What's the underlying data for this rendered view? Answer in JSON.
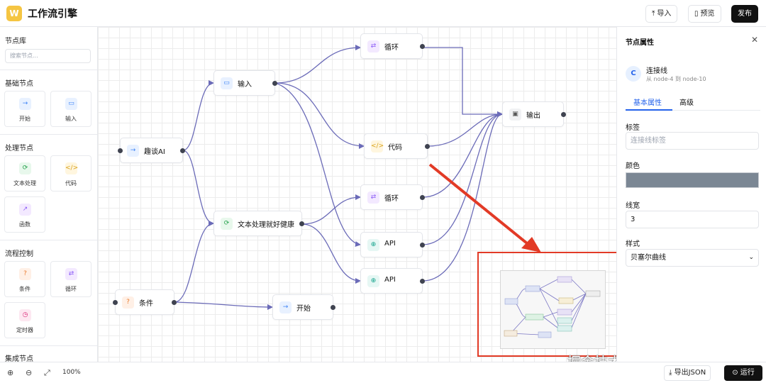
{
  "header": {
    "logo_letter": "W",
    "title": "工作流引擎",
    "import_label": "导入",
    "preview_label": "预览",
    "publish_label": "发布"
  },
  "sidebar": {
    "library_title": "节点库",
    "search_placeholder": "搜索节点...",
    "sections": [
      {
        "title": "基础节点",
        "items": [
          {
            "label": "开始",
            "icon": "arrow-right-icon"
          },
          {
            "label": "输入",
            "icon": "message-icon"
          }
        ]
      },
      {
        "title": "处理节点",
        "items": [
          {
            "label": "文本处理",
            "icon": "refresh-icon"
          },
          {
            "label": "代码",
            "icon": "code-icon"
          },
          {
            "label": "函数",
            "icon": "external-link-icon"
          }
        ]
      },
      {
        "title": "流程控制",
        "items": [
          {
            "label": "条件",
            "icon": "question-icon"
          },
          {
            "label": "循环",
            "icon": "loop-icon"
          },
          {
            "label": "定时器",
            "icon": "clock-icon"
          }
        ]
      },
      {
        "title": "集成节点",
        "items": []
      }
    ]
  },
  "canvas": {
    "nodes": [
      {
        "id": "quwan",
        "label": "趣谈AI",
        "icon": "arrow-right-icon"
      },
      {
        "id": "input",
        "label": "输入",
        "icon": "message-icon"
      },
      {
        "id": "loop1",
        "label": "循环",
        "icon": "loop-icon"
      },
      {
        "id": "output",
        "label": "输出",
        "icon": "image-icon"
      },
      {
        "id": "code",
        "label": "代码",
        "icon": "code-icon"
      },
      {
        "id": "text",
        "label": "文本处理就好健康",
        "icon": "refresh-icon"
      },
      {
        "id": "loop2",
        "label": "循环",
        "icon": "loop-icon"
      },
      {
        "id": "api1",
        "label": "API",
        "icon": "globe-icon"
      },
      {
        "id": "api2",
        "label": "API",
        "icon": "globe-icon"
      },
      {
        "id": "cond",
        "label": "条件",
        "icon": "question-icon"
      },
      {
        "id": "start",
        "label": "开始",
        "icon": "arrow-right-icon"
      }
    ],
    "edge_color": "#6b6bb8",
    "annotation_color": "#e23a26",
    "watermark": "掘金技术社区 @ 徐小夕"
  },
  "panel": {
    "title": "节点属性",
    "connection_initial": "C",
    "connection_title": "连接线",
    "connection_subtitle": "从 node-4 到 node-10",
    "tabs": [
      {
        "label": "基本属性"
      },
      {
        "label": "高级"
      }
    ],
    "label_field": {
      "label": "标签",
      "placeholder": "连接线标签",
      "value": ""
    },
    "color_field": {
      "label": "颜色",
      "value": "#7b8794"
    },
    "width_field": {
      "label": "线宽",
      "value": "3"
    },
    "style_field": {
      "label": "样式",
      "value": "贝塞尔曲线"
    }
  },
  "footer": {
    "zoom": "100%",
    "export_label": "导出JSON",
    "run_label": "运行"
  }
}
